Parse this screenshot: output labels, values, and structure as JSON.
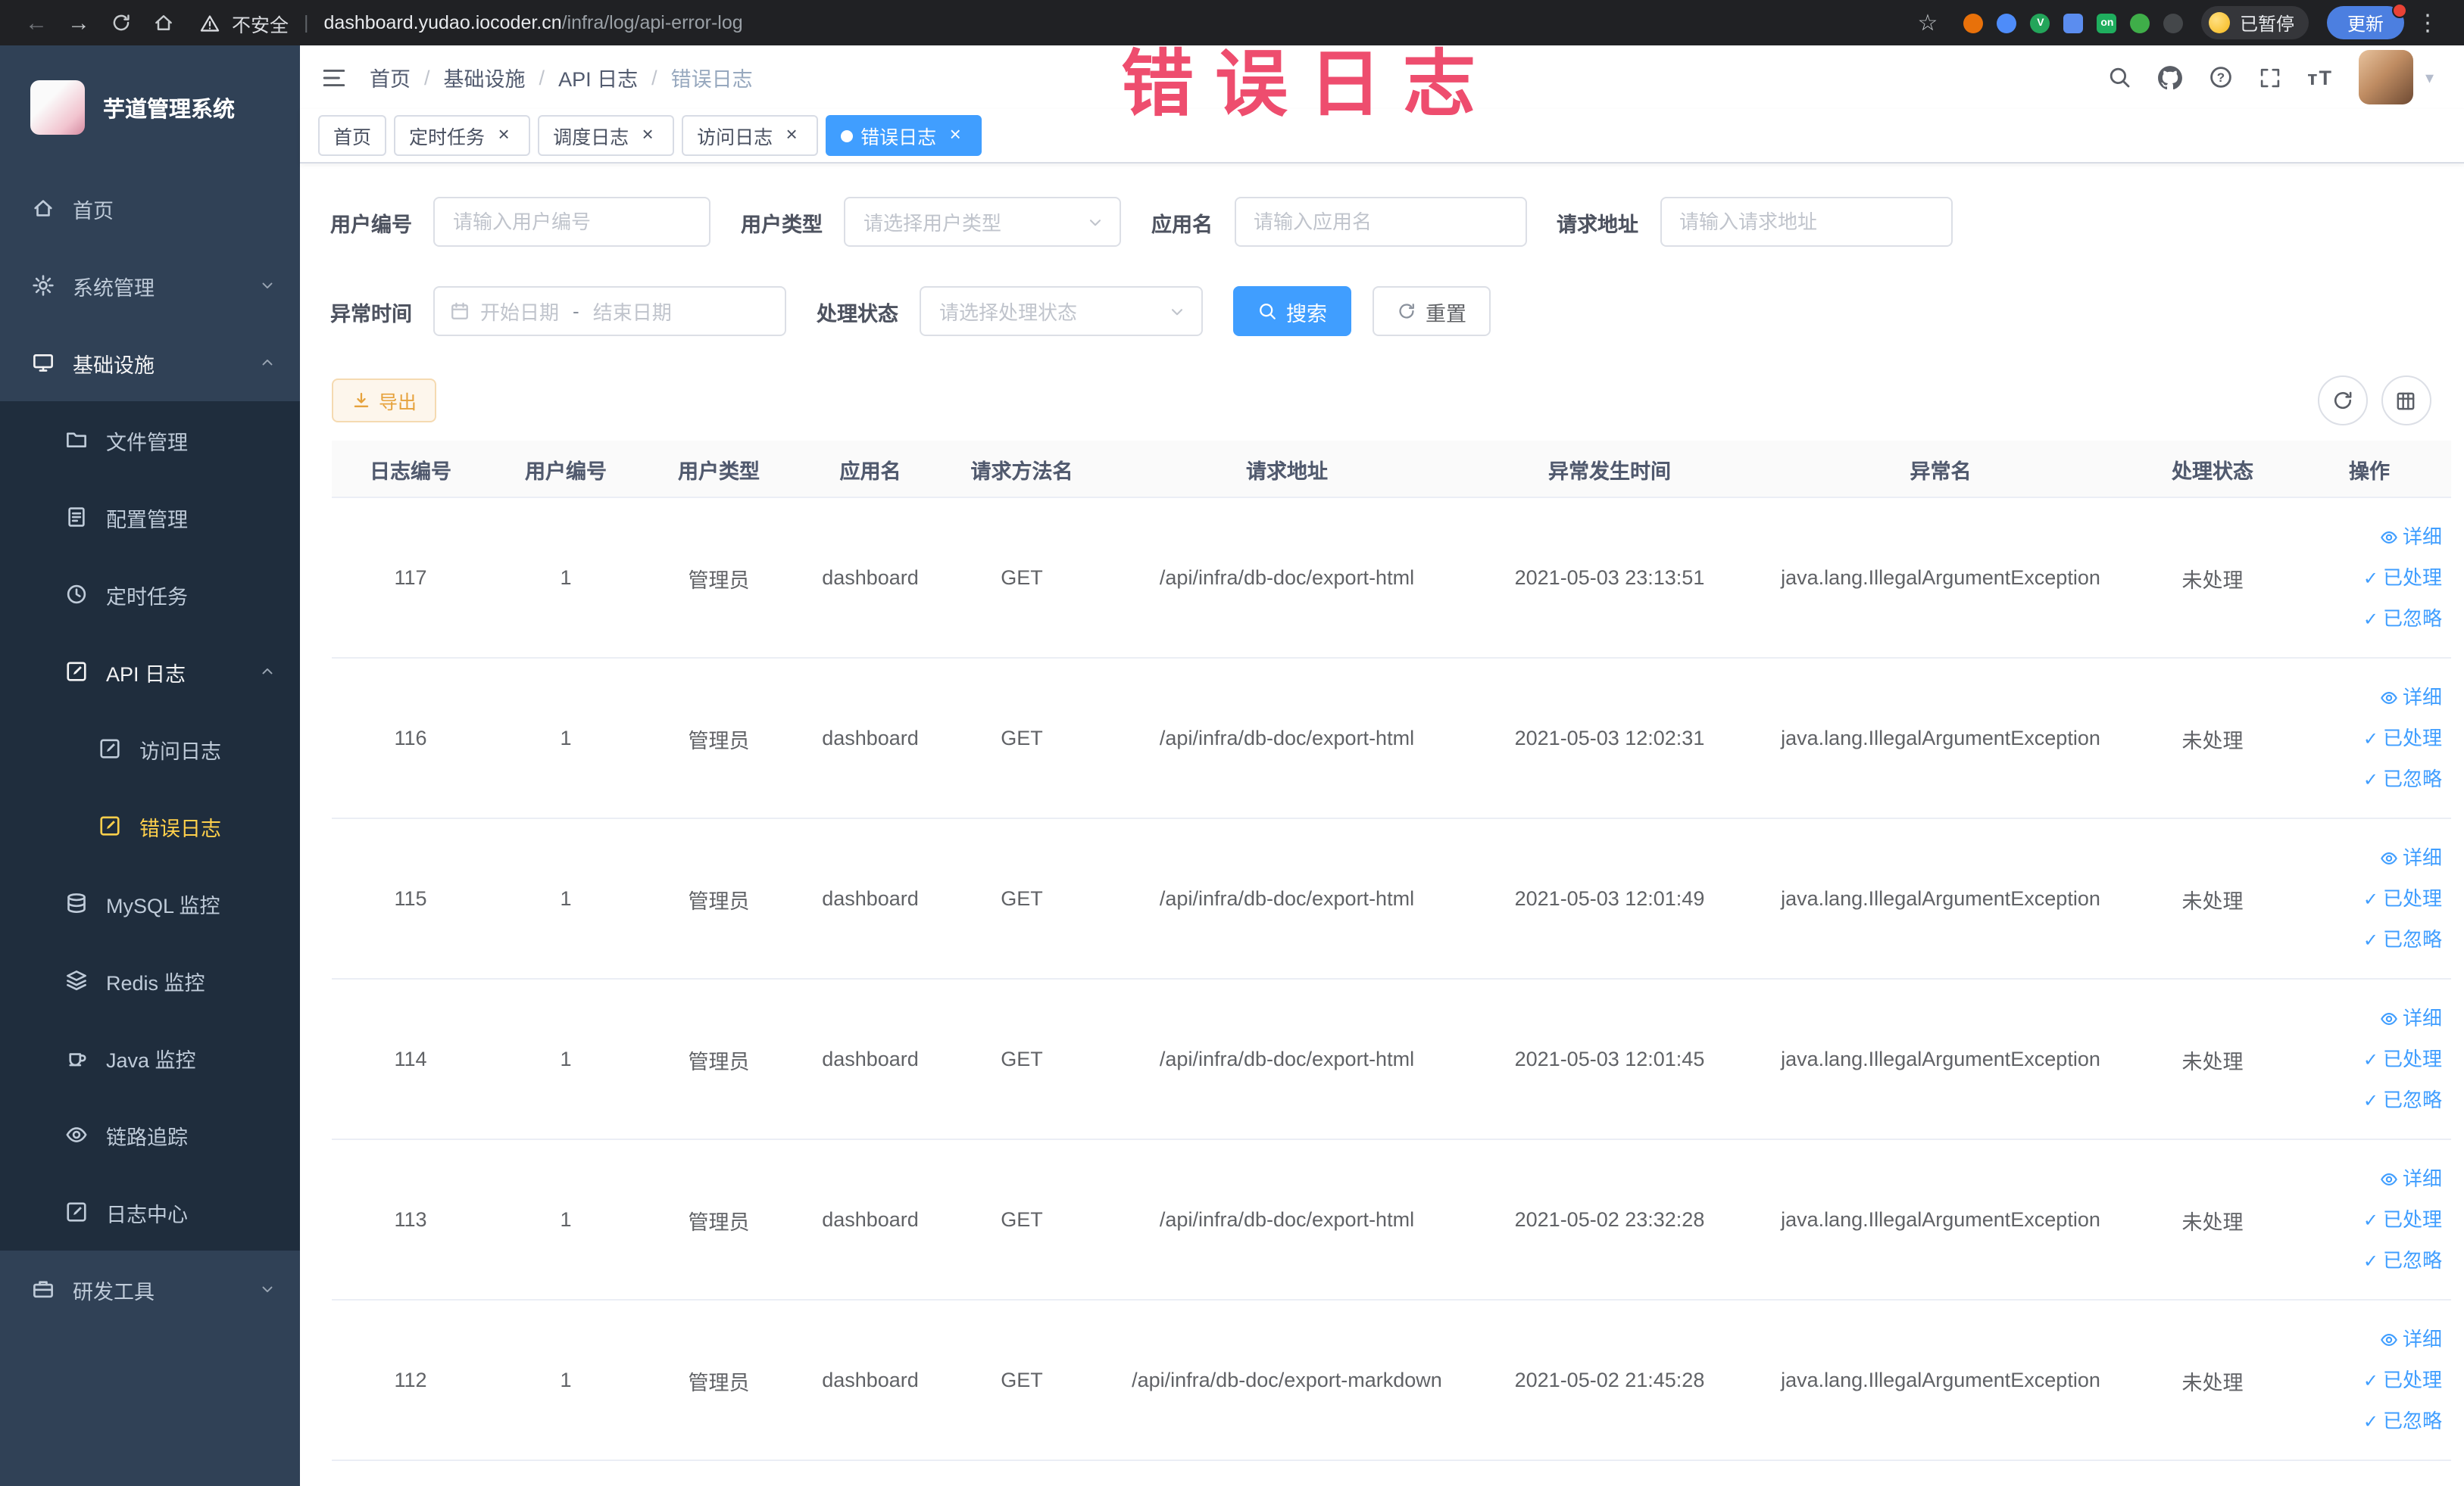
{
  "annotation": "错误日志",
  "colors": {
    "primary": "#409eff",
    "sidebar_bg": "#304156",
    "sidebar_active_text": "#ffd04b",
    "export_warning": "#e6a23c",
    "annotation_red": "#ee4d6e"
  },
  "browser": {
    "security_label": "不安全",
    "url_host": "dashboard.yudao.iocoder.cn",
    "url_path": "/infra/log/api-error-log",
    "paused_badge": "已暂停",
    "update_button": "更新",
    "extensions": [
      {
        "key": "orange-ext",
        "color": "#e8710a",
        "shape": "ci",
        "glyph": ""
      },
      {
        "key": "blue-drop-ext",
        "color": "#4e8cf9",
        "shape": "ci",
        "glyph": ""
      },
      {
        "key": "green-v-ext",
        "color": "#23a55a",
        "shape": "ci",
        "glyph": "V"
      },
      {
        "key": "blue-grid-ext",
        "color": "#5b8def",
        "shape": "sq",
        "glyph": ""
      },
      {
        "key": "on-badge-ext",
        "color": "#1fae5e",
        "shape": "sq",
        "glyph": "on"
      },
      {
        "key": "green-tree-ext",
        "color": "#3fae49",
        "shape": "ci",
        "glyph": ""
      },
      {
        "key": "dark-pin-ext",
        "color": "#44474a",
        "shape": "ci",
        "glyph": ""
      }
    ]
  },
  "sidebar": {
    "title": "芋道管理系统",
    "items": [
      {
        "key": "home",
        "label": "首页",
        "icon": "home-icon",
        "depth": 0
      },
      {
        "key": "system",
        "label": "系统管理",
        "icon": "gear-icon",
        "depth": 0,
        "arrow": "down"
      },
      {
        "key": "infra",
        "label": "基础设施",
        "icon": "monitor-icon",
        "depth": 0,
        "arrow": "up",
        "open": true
      },
      {
        "key": "file",
        "label": "文件管理",
        "icon": "folder-icon",
        "depth": 1
      },
      {
        "key": "config",
        "label": "配置管理",
        "icon": "doc-icon",
        "depth": 1
      },
      {
        "key": "job",
        "label": "定时任务",
        "icon": "clock-icon",
        "depth": 1
      },
      {
        "key": "api-log",
        "label": "API 日志",
        "icon": "edit-icon",
        "depth": 1,
        "arrow": "up",
        "open": true
      },
      {
        "key": "access-log",
        "label": "访问日志",
        "icon": "edit-icon",
        "depth": 2
      },
      {
        "key": "error-log",
        "label": "错误日志",
        "icon": "edit-icon",
        "depth": 2,
        "active": true
      },
      {
        "key": "mysql",
        "label": "MySQL 监控",
        "icon": "database-icon",
        "depth": 1
      },
      {
        "key": "redis",
        "label": "Redis 监控",
        "icon": "layers-icon",
        "depth": 1
      },
      {
        "key": "java",
        "label": "Java 监控",
        "icon": "java-cup-icon",
        "depth": 1
      },
      {
        "key": "trace",
        "label": "链路追踪",
        "icon": "eye-icon",
        "depth": 1
      },
      {
        "key": "log-center",
        "label": "日志中心",
        "icon": "edit-icon",
        "depth": 1
      },
      {
        "key": "dev-tools",
        "label": "研发工具",
        "icon": "toolbox-icon",
        "depth": 0,
        "arrow": "down"
      }
    ]
  },
  "header": {
    "breadcrumb": [
      "首页",
      "基础设施",
      "API 日志",
      "错误日志"
    ]
  },
  "tabs": [
    {
      "key": "home",
      "label": "首页",
      "closable": false,
      "active": false
    },
    {
      "key": "job",
      "label": "定时任务",
      "closable": true,
      "active": false
    },
    {
      "key": "job-log",
      "label": "调度日志",
      "closable": true,
      "active": false
    },
    {
      "key": "access-log",
      "label": "访问日志",
      "closable": true,
      "active": false
    },
    {
      "key": "error-log",
      "label": "错误日志",
      "closable": true,
      "active": true
    }
  ],
  "filters": {
    "user_id": {
      "label": "用户编号",
      "placeholder": "请输入用户编号"
    },
    "user_type": {
      "label": "用户类型",
      "placeholder": "请选择用户类型"
    },
    "app_name": {
      "label": "应用名",
      "placeholder": "请输入应用名"
    },
    "request_url": {
      "label": "请求地址",
      "placeholder": "请输入请求地址"
    },
    "exception_time": {
      "label": "异常时间",
      "start_placeholder": "开始日期",
      "separator": "-",
      "end_placeholder": "结束日期"
    },
    "process_status": {
      "label": "处理状态",
      "placeholder": "请选择处理状态"
    },
    "search_button": "搜索",
    "reset_button": "重置"
  },
  "toolbar": {
    "export_button": "导出"
  },
  "table": {
    "columns": [
      {
        "key": "id",
        "label": "日志编号"
      },
      {
        "key": "user_id",
        "label": "用户编号"
      },
      {
        "key": "user_type",
        "label": "用户类型"
      },
      {
        "key": "app",
        "label": "应用名"
      },
      {
        "key": "method",
        "label": "请求方法名"
      },
      {
        "key": "url",
        "label": "请求地址"
      },
      {
        "key": "time",
        "label": "异常发生时间"
      },
      {
        "key": "exception",
        "label": "异常名"
      },
      {
        "key": "status",
        "label": "处理状态"
      },
      {
        "key": "actions",
        "label": "操作"
      }
    ],
    "actions": [
      {
        "key": "detail",
        "label": "详细",
        "icon": "eye-icon"
      },
      {
        "key": "processed",
        "label": "已处理",
        "icon": "check-icon"
      },
      {
        "key": "ignored",
        "label": "已忽略",
        "icon": "check-icon"
      }
    ],
    "rows": [
      {
        "id": "117",
        "user_id": "1",
        "user_type": "管理员",
        "app": "dashboard",
        "method": "GET",
        "url": "/api/infra/db-doc/export-html",
        "time": "2021-05-03 23:13:51",
        "exception": "java.lang.IllegalArgumentException",
        "status": "未处理"
      },
      {
        "id": "116",
        "user_id": "1",
        "user_type": "管理员",
        "app": "dashboard",
        "method": "GET",
        "url": "/api/infra/db-doc/export-html",
        "time": "2021-05-03 12:02:31",
        "exception": "java.lang.IllegalArgumentException",
        "status": "未处理"
      },
      {
        "id": "115",
        "user_id": "1",
        "user_type": "管理员",
        "app": "dashboard",
        "method": "GET",
        "url": "/api/infra/db-doc/export-html",
        "time": "2021-05-03 12:01:49",
        "exception": "java.lang.IllegalArgumentException",
        "status": "未处理"
      },
      {
        "id": "114",
        "user_id": "1",
        "user_type": "管理员",
        "app": "dashboard",
        "method": "GET",
        "url": "/api/infra/db-doc/export-html",
        "time": "2021-05-03 12:01:45",
        "exception": "java.lang.IllegalArgumentException",
        "status": "未处理"
      },
      {
        "id": "113",
        "user_id": "1",
        "user_type": "管理员",
        "app": "dashboard",
        "method": "GET",
        "url": "/api/infra/db-doc/export-html",
        "time": "2021-05-02 23:32:28",
        "exception": "java.lang.IllegalArgumentException",
        "status": "未处理"
      },
      {
        "id": "112",
        "user_id": "1",
        "user_type": "管理员",
        "app": "dashboard",
        "method": "GET",
        "url": "/api/infra/db-doc/export-markdown",
        "time": "2021-05-02 21:45:28",
        "exception": "java.lang.IllegalArgumentException",
        "status": "未处理"
      }
    ]
  }
}
